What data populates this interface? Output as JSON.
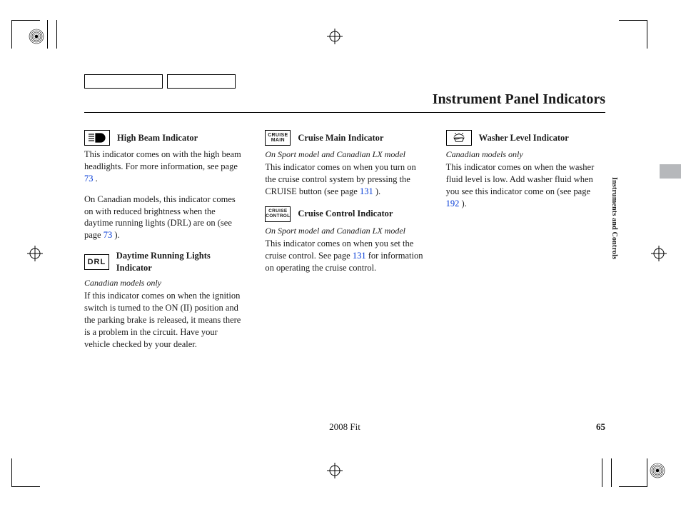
{
  "header": {
    "title": "Instrument Panel Indicators"
  },
  "side_label": "Instruments and Controls",
  "footer": {
    "model": "2008  Fit",
    "page_number": "65"
  },
  "col1": {
    "high_beam": {
      "heading": "High Beam Indicator",
      "p1a": "This indicator comes on with the high beam headlights. For more information, see page  ",
      "p1_link": "73",
      "p1b": "  .",
      "p2a": "On Canadian models, this indicator comes on with reduced brightness when the daytime running lights (DRL) are on (see page ",
      "p2_link": "73",
      "p2b": " )."
    },
    "drl": {
      "icon_text": "DRL",
      "heading": "Daytime Running Lights Indicator",
      "note": "Canadian models only",
      "p": "If this indicator comes on when the ignition switch is turned to the ON (II) position and the parking brake is released, it means there is a problem in the circuit. Have your vehicle checked by your dealer."
    }
  },
  "col2": {
    "cruise_main": {
      "icon_text": "CRUISE\nMAIN",
      "heading": "Cruise Main Indicator",
      "note": "On Sport model and Canadian LX model",
      "p_a": "This indicator comes on when you turn on the cruise control system by pressing the CRUISE button (see page ",
      "p_link": "131",
      "p_b": " )."
    },
    "cruise_ctrl": {
      "icon_text": "CRUISE\nCONTROL",
      "heading": "Cruise Control Indicator",
      "note": "On Sport model and Canadian LX model",
      "p_a": "This indicator comes on when you set the cruise control. See page  ",
      "p_link": "131",
      "p_b": " for information on operating the cruise control."
    }
  },
  "col3": {
    "washer": {
      "heading": "Washer Level Indicator",
      "note": "Canadian models only",
      "p_a": "This indicator comes on when the washer fluid level is low. Add washer fluid when you see this indicator come on (see page ",
      "p_link": "192",
      "p_b": " )."
    }
  }
}
